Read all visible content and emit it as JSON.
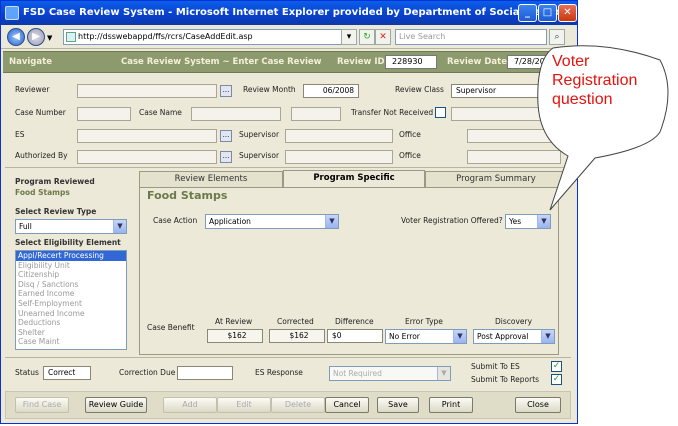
{
  "window": {
    "title": "FSD Case Review System - Microsoft Internet Explorer provided by Department of Social Services"
  },
  "browser": {
    "url": "http://dsswebappd/ffs/rcrs/CaseAddEdit.asp",
    "search_placeholder": "Live Search"
  },
  "header": {
    "navigate": "Navigate",
    "page_title": "Case Review System ~ Enter Case Review",
    "review_id_label": "Review ID",
    "review_id": "228930",
    "review_date_label": "Review Date",
    "review_date": "7/28/20"
  },
  "form": {
    "reviewer_label": "Reviewer",
    "review_month_label": "Review Month",
    "review_month": "06/2008",
    "review_class_label": "Review Class",
    "review_class": "Supervisor",
    "case_number_label": "Case Number",
    "case_name_label": "Case Name",
    "transfer_label": "Transfer Not Received",
    "es_label": "ES",
    "supervisor_label": "Supervisor",
    "office_label": "Office",
    "authorized_by_label": "Authorized By",
    "ellipsis": "..."
  },
  "left": {
    "program_reviewed_label": "Program Reviewed",
    "program": "Food Stamps",
    "review_type_label": "Select Review Type",
    "review_type": "Full",
    "eligibility_label": "Select Eligibility Element",
    "elements": [
      "Appl/Recert Processing",
      "Eligibility Unit",
      "Citizenship",
      "Disq / Sanctions",
      "Earned Income",
      "Self-Employment",
      "Unearned Income",
      "Deductions",
      "Shelter",
      "Case Maint"
    ]
  },
  "tabs": [
    "Review Elements",
    "Program Specific",
    "Program Summary"
  ],
  "section": {
    "title": "Food Stamps",
    "case_action_label": "Case Action",
    "case_action": "Application",
    "voter_label": "Voter Registration Offered?",
    "voter_value": "Yes",
    "case_benefit_label": "Case Benefit",
    "cols": {
      "at_review": "At Review",
      "corrected": "Corrected",
      "difference": "Difference",
      "error_type": "Error Type",
      "discovery": "Discovery"
    },
    "at_review": "$162",
    "corrected": "$162",
    "difference": "$0",
    "error_type": "No Error",
    "discovery": "Post Approval"
  },
  "status": {
    "status_label": "Status",
    "status": "Correct",
    "correction_due_label": "Correction Due",
    "es_response_label": "ES Response",
    "es_response": "Not Required",
    "submit_es_label": "Submit To ES",
    "submit_reports_label": "Submit To Reports"
  },
  "buttons": {
    "find_case": "Find Case",
    "review_guide": "Review Guide",
    "add": "Add",
    "edit": "Edit",
    "delete": "Delete",
    "cancel": "Cancel",
    "save": "Save",
    "print": "Print",
    "close": "Close"
  },
  "callout": {
    "text": "Voter Registration question"
  },
  "colors": {
    "header_bg": "#8c9a6e",
    "section_title": "#6b7a49",
    "callout_text": "#e5120e",
    "title_bar": "#0a3fcc"
  }
}
